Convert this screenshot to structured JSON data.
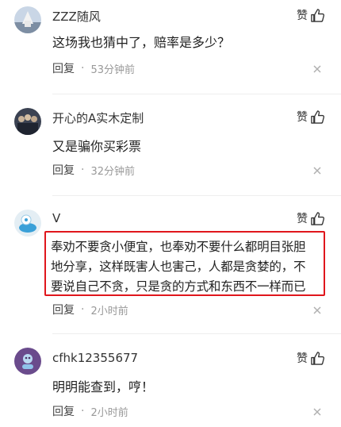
{
  "comments": [
    {
      "username": "ZZZ随风",
      "text": "这场我也猜中了，赔率是多少？",
      "reply_label": "回复",
      "separator": "·",
      "time": "53分钟前",
      "like_label": "赞"
    },
    {
      "username": "开心的A实木定制",
      "text": "又是骗你买彩票",
      "reply_label": "回复",
      "separator": "·",
      "time": "32分钟前",
      "like_label": "赞"
    },
    {
      "username": "V",
      "text_lines": [
        "奉劝不要贪小便宜，也奉劝不要什么都明目张胆",
        "地分享，这样既害人也害己，人都是贪婪的，不",
        "要说自己不贪，只是贪的方式和东西不一样而已"
      ],
      "reply_label": "回复",
      "separator": "·",
      "time": "2小时前",
      "like_label": "赞"
    },
    {
      "username": "cfhk12355677",
      "text": "明明能查到，哼！",
      "reply_label": "回复",
      "separator": "·",
      "time": "2小时前",
      "like_label": "赞"
    }
  ],
  "colors": {
    "highlight_border": "#e0161c",
    "meta_text": "#999999"
  }
}
